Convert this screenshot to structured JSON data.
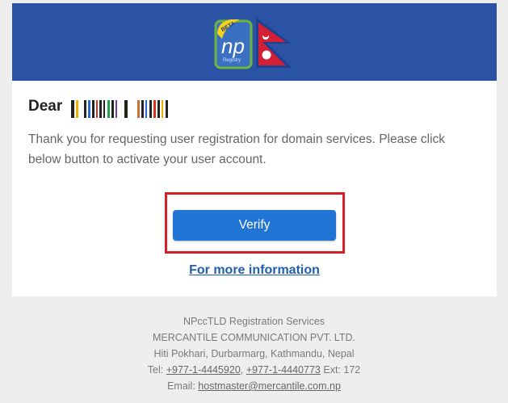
{
  "header": {
    "logo_badge": "BETA",
    "logo_text": "np",
    "logo_sub": "Registry"
  },
  "greeting": {
    "prefix": "Dear"
  },
  "message": {
    "text": "Thank you for requesting user registration for domain services. Please click below button to activate your user account."
  },
  "actions": {
    "verify_label": "Verify",
    "more_info_label": "For more information"
  },
  "footer": {
    "org": "NPccTLD Registration Services",
    "company": "MERCANTILE COMMUNICATION PVT. LTD.",
    "address": "Hiti Pokhari, Durbarmarg, Kathmandu, Nepal",
    "tel_label": "Tel:",
    "tel1": "+977-1-4445920",
    "tel_sep": ",",
    "tel2": "+977-1-4440773",
    "ext": "Ext: 172",
    "email_label": "Email:",
    "email": "hostmaster@mercantile.com.np"
  },
  "colors": {
    "header_bg": "#2a53a5",
    "button_bg": "#1f74d4",
    "highlight_border": "#d91f26",
    "link": "#1f5fae"
  }
}
